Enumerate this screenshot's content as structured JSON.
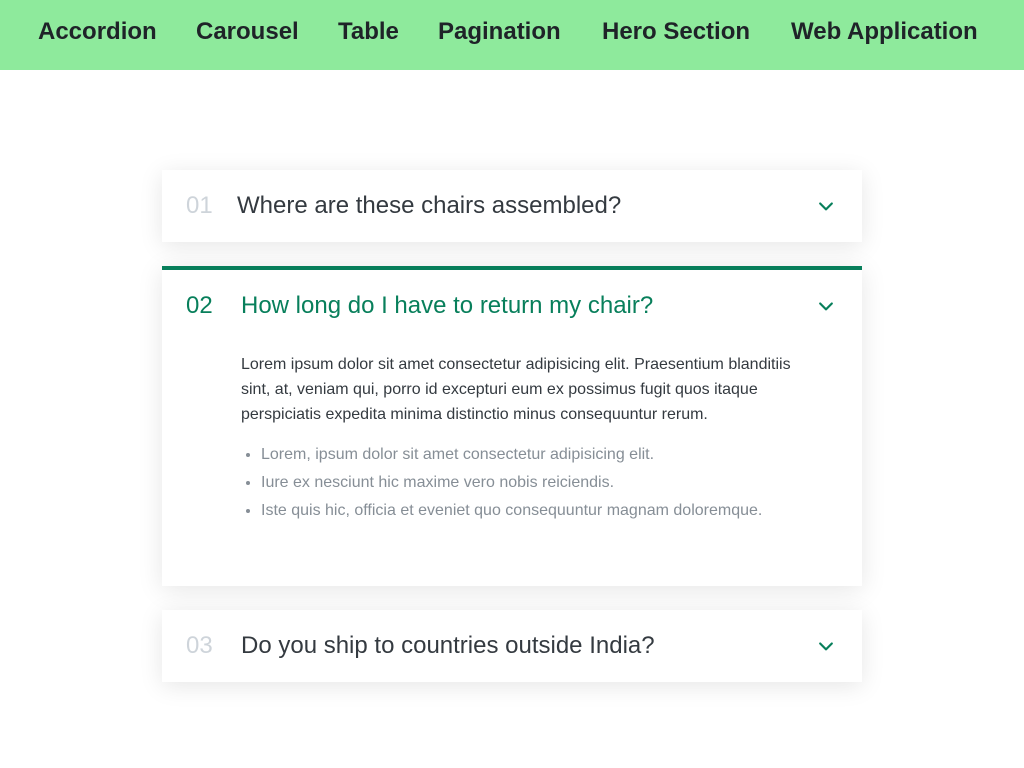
{
  "nav": {
    "items": [
      {
        "label": "Accordion"
      },
      {
        "label": "Carousel"
      },
      {
        "label": "Table"
      },
      {
        "label": "Pagination"
      },
      {
        "label": "Hero Section"
      },
      {
        "label": "Web Application"
      }
    ]
  },
  "accordion": {
    "items": [
      {
        "number": "01",
        "question": "Where are these chairs assembled?",
        "state": "collapsed",
        "icon": "chevron-down-icon"
      },
      {
        "number": "02",
        "question": "How long do I have to return my chair?",
        "state": "expanded",
        "icon": "chevron-down-icon",
        "answer": "Lorem ipsum dolor sit amet consectetur adipisicing elit. Praesentium blanditiis sint, at, veniam qui, porro id excepturi eum ex possimus fugit quos itaque perspiciatis expedita minima distinctio minus consequuntur rerum.",
        "bullets": [
          "Lorem, ipsum dolor sit amet consectetur adipisicing elit.",
          "Iure ex nesciunt hic maxime vero nobis reiciendis.",
          "Iste quis hic, officia et eveniet quo consequuntur magnam doloremque."
        ]
      },
      {
        "number": "03",
        "question": "Do you ship to countries outside India?",
        "state": "collapsed",
        "icon": "chevron-down-icon"
      }
    ]
  },
  "colors": {
    "nav_bg": "#8eea9c",
    "accent": "#087f5b",
    "text": "#343a40",
    "muted": "#ced4da",
    "bullet_text": "#868e96"
  }
}
